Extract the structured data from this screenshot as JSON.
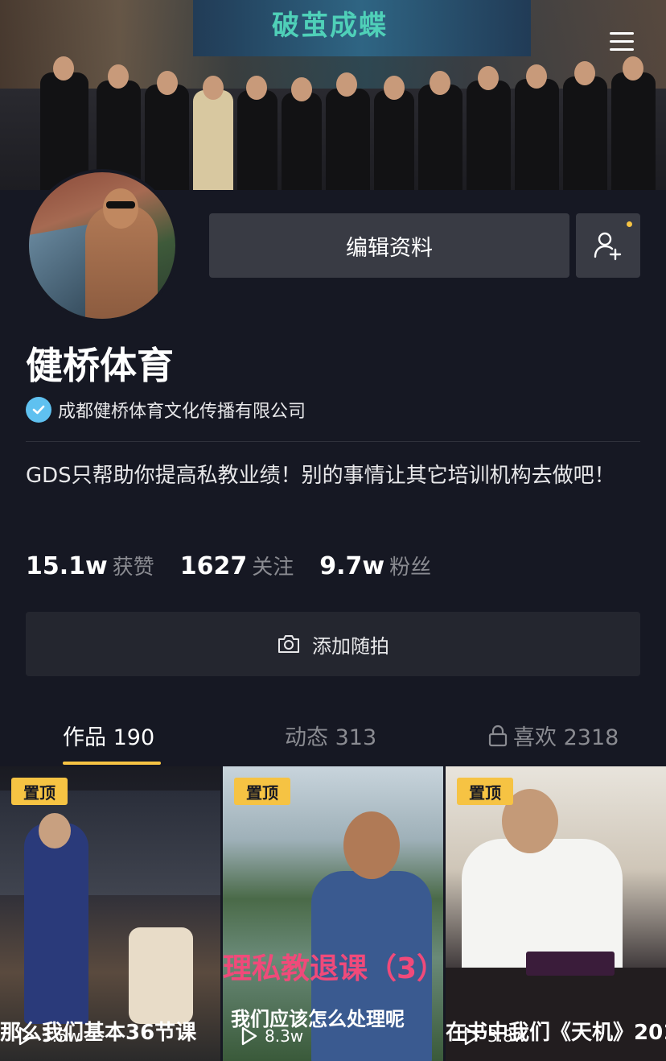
{
  "cover": {
    "screen_text": "破茧成蝶",
    "menu_icon": "hamburger-menu-icon"
  },
  "profile": {
    "name": "健桥体育",
    "verified_org": "成都健桥体育文化传播有限公司",
    "bio": "GDS只帮助你提高私教业绩！别的事情让其它培训机构去做吧！",
    "edit_button": "编辑资料",
    "add_friend_icon": "add-friend-icon"
  },
  "stats": [
    {
      "num": "15.1w",
      "label": "获赞"
    },
    {
      "num": "1627",
      "label": "关注"
    },
    {
      "num": "9.7w",
      "label": "粉丝"
    }
  ],
  "add_snap": {
    "label": "添加随拍",
    "icon": "camera-icon"
  },
  "tabs": [
    {
      "label": "作品 190",
      "active": true
    },
    {
      "label": "动态 313",
      "active": false
    },
    {
      "label": "喜欢 2318",
      "active": false,
      "icon": "lock-icon"
    }
  ],
  "videos": [
    {
      "pinned": "置顶",
      "plays": "3.5w",
      "caption": "那么我们基本36节课"
    },
    {
      "pinned": "置顶",
      "plays": "8.3w",
      "caption": "我们应该怎么处理呢",
      "title_overlay": "理私教退课（3）"
    },
    {
      "pinned": "置顶",
      "plays": "3.8w",
      "caption": "在书中我们《天机》201"
    }
  ],
  "colors": {
    "background": "#161823",
    "accent": "#f6c343",
    "button": "#393b44",
    "muted": "#8a8b91",
    "verified": "#5fc1f0"
  }
}
